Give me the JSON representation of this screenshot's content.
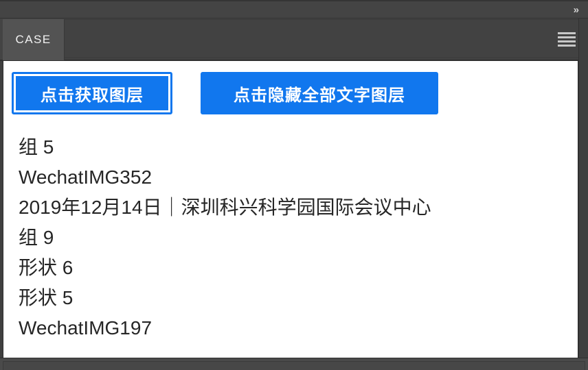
{
  "window": {
    "collapse_chevrons": "»"
  },
  "tab_bar": {
    "active_tab_label": "CASE",
    "panel_menu_icon": "hamburger-menu-icon"
  },
  "toolbar": {
    "get_layers_label": "点击获取图层",
    "hide_text_layers_label": "点击隐藏全部文字图层",
    "accent_color": "#1177ee"
  },
  "layer_list": {
    "items": [
      {
        "name": "组 5"
      },
      {
        "name": "WechatIMG352"
      },
      {
        "name": "2019年12月14日｜深圳科兴科学园国际会议中心"
      },
      {
        "name": "组 9"
      },
      {
        "name": "形状 6"
      },
      {
        "name": "形状 5"
      },
      {
        "name": "WechatIMG197"
      }
    ]
  }
}
